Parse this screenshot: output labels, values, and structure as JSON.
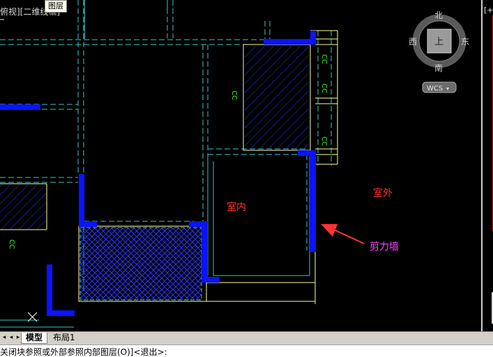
{
  "viewport": {
    "label": "俯视][二维线框]",
    "tooltip": "图层"
  },
  "viewcube": {
    "north": "北",
    "south": "南",
    "east": "东",
    "west": "西",
    "top_face": "上",
    "wcs_label": "WCS"
  },
  "drawing": {
    "indoor_label": "室内",
    "outdoor_label": "室外",
    "shear_wall_label": "剪力墙",
    "dimension_marks": [
      "CC",
      "CC",
      "CC",
      "CC",
      "CC"
    ],
    "colors": {
      "shear_wall": "#0a14ff",
      "axis_line": "#38c8c8",
      "outline": "#ffffa0",
      "hatch": "#2b34ff",
      "text_indoor": "#ff3333",
      "text_outdoor": "#ff3333",
      "text_wall": "#ff44ff",
      "arrow": "#ff3333",
      "mark": "#33ff33"
    }
  },
  "right_pane": {
    "label": "[+]"
  },
  "tabs": {
    "model": "模型",
    "layout1": "布局1"
  },
  "command_line": {
    "text": "关闭块参照或外部参照内部图层(O)]<退出>:"
  }
}
